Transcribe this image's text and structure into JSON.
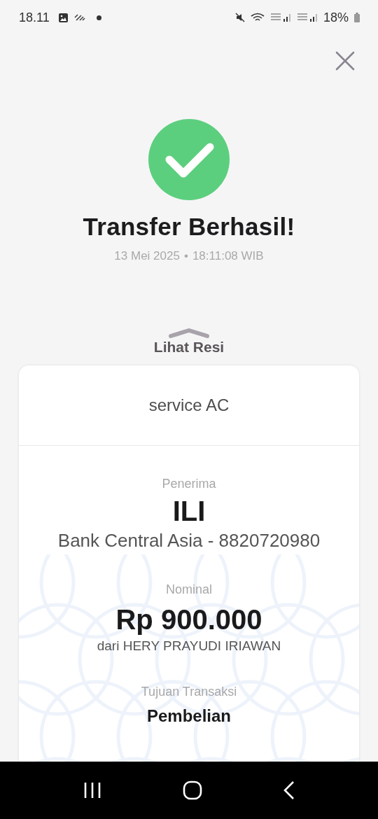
{
  "status_bar": {
    "time": "18.11",
    "battery": "18%"
  },
  "result": {
    "title": "Transfer Berhasil!",
    "date": "13 Mei 2025",
    "separator": "•",
    "time": "18:11:08 WIB"
  },
  "receipt_toggle": {
    "label": "Lihat Resi"
  },
  "receipt": {
    "note": "service AC",
    "sections": [
      {
        "kind": "name",
        "label": "Penerima",
        "value": "ILI",
        "detail": "Bank Central Asia - 8820720980"
      },
      {
        "kind": "amount",
        "label": "Nominal",
        "value": "Rp 900.000",
        "detail": "dari HERY PRAYUDI IRIAWAN"
      },
      {
        "kind": "purpose",
        "label": "Tujuan Transaksi",
        "value": "Pembelian"
      }
    ]
  }
}
